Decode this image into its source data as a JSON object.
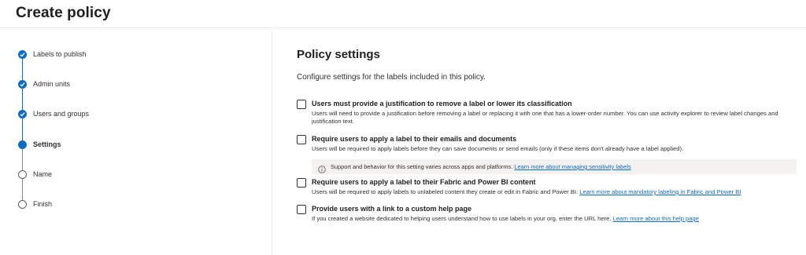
{
  "header": {
    "title": "Create policy"
  },
  "stepper": {
    "steps": [
      {
        "label": "Labels to publish",
        "state": "done"
      },
      {
        "label": "Admin units",
        "state": "done"
      },
      {
        "label": "Users and groups",
        "state": "done"
      },
      {
        "label": "Settings",
        "state": "current"
      },
      {
        "label": "Name",
        "state": "todo"
      },
      {
        "label": "Finish",
        "state": "todo"
      }
    ]
  },
  "main": {
    "title": "Policy settings",
    "description": "Configure settings for the labels included in this policy.",
    "options": [
      {
        "title": "Users must provide a justification to remove a label or lower its classification",
        "description": "Users will need to provide a justification before removing a label or replacing it with one that has a lower-order number. You can use activity explorer to review label changes and justification text.",
        "link": "",
        "checked": false
      },
      {
        "title": "Require users to apply a label to their emails and documents",
        "description": "Users will be required to apply labels before they can save documents or send emails (only if these items don't already have a label applied).",
        "link": "",
        "checked": false,
        "info": {
          "text": "Support and behavior for this setting varies across apps and platforms.",
          "link": "Learn more about managing sensitivity labels"
        }
      },
      {
        "title": "Require users to apply a label to their Fabric and Power BI content",
        "description": "Users will be required to apply labels to unlabeled content they create or edit in Fabric and Power BI.",
        "link": "Learn more about mandatory labeling in Fabric and Power BI",
        "checked": false
      },
      {
        "title": "Provide users with a link to a custom help page",
        "description": "If you created a website dedicated to helping users understand how to use labels in your org, enter the URL here.",
        "link": "Learn more about this help page",
        "checked": false
      }
    ]
  },
  "colors": {
    "accent": "#0f6cbd",
    "info_bg": "#f3f2f1"
  },
  "icons": {
    "step_done": "checkmark-icon",
    "info": "info-icon"
  }
}
